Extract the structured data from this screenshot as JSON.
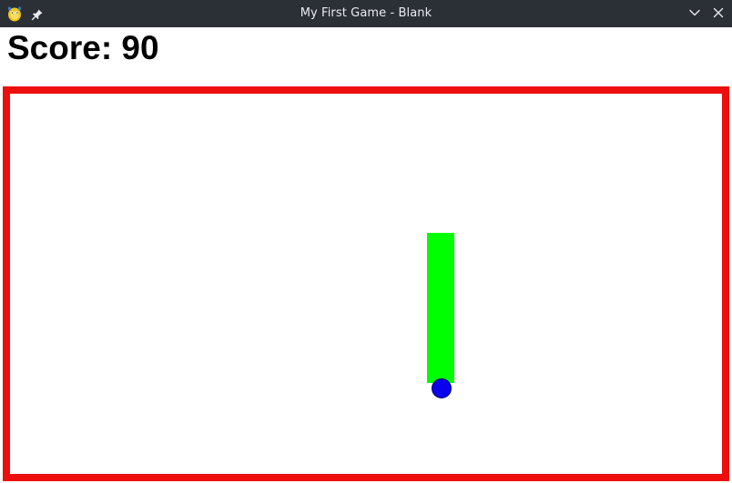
{
  "window": {
    "title": "My First Game - Blank",
    "icons": {
      "app": "python-icon",
      "pin": "pin-icon",
      "minimize": "chevron-down-icon",
      "close": "close-icon"
    },
    "titlebar_color": "#2b2f36"
  },
  "game": {
    "score_text": "Score: 90",
    "colors": {
      "border": "#ee0e0e",
      "paddle": "#00ff00",
      "ball": "#0a00ee",
      "background": "#ffffff"
    }
  }
}
